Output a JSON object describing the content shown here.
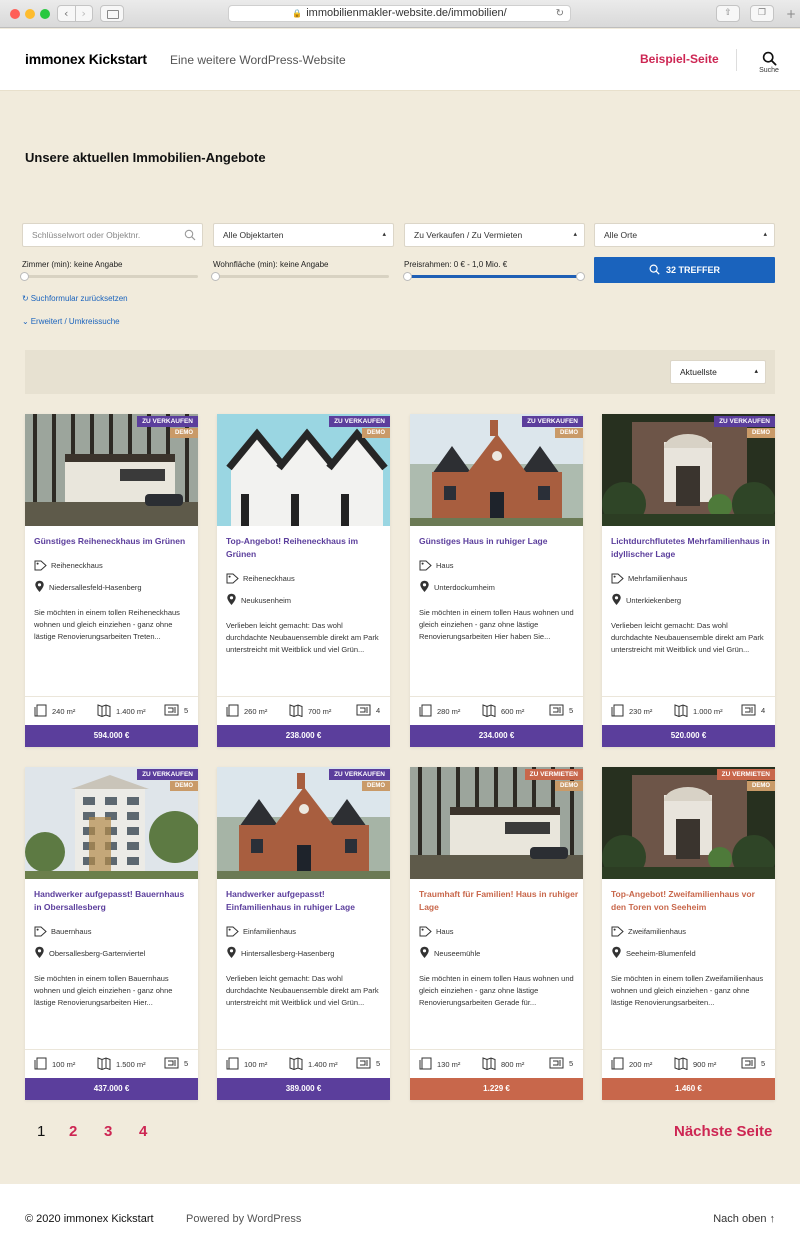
{
  "browser": {
    "url": "immobilienmakler-website.de/immobilien/"
  },
  "header": {
    "site_title": "immonex Kickstart",
    "site_description": "Eine weitere WordPress-Website",
    "menu_item": "Beispiel-Seite",
    "search_label": "Suche"
  },
  "page": {
    "title": "Unsere aktuellen Immobilien-Angebote"
  },
  "search_form": {
    "keyword_placeholder": "Schlüsselwort oder Objektnr.",
    "type_select": "Alle Objektarten",
    "marketing_select": "Zu Verkaufen / Zu Vermieten",
    "location_select": "Alle Orte",
    "rooms_label": "Zimmer (min): keine Angabe",
    "area_label": "Wohnfläche (min): keine Angabe",
    "price_label": "Preisrahmen: 0 € - 1,0 Mio. €",
    "submit_label": "32 TREFFER",
    "reset_link": "Suchformular zurücksetzen",
    "extended_link": "Erweitert / Umkreissuche"
  },
  "sort": {
    "selected": "Aktuellste"
  },
  "colors": {
    "sale": "#5b3e9c",
    "rent": "#c8674b",
    "demo": "#c99a68",
    "accent": "#cd2653",
    "button": "#1a63bd"
  },
  "listings": [
    {
      "badge": "ZU VERKAUFEN",
      "demo": "DEMO",
      "title": "Günstiges Reiheneckhaus im Grünen",
      "type": "Reiheneckhaus",
      "location": "Niedersallesfeld-Hasenberg",
      "description": "Sie möchten in einem tollen Reiheneckhaus wohnen und gleich einziehen - ganz ohne lästige Renovierungsarbeiten Treten...",
      "living_area": "240 m²",
      "plot_area": "1.400 m²",
      "rooms": "5",
      "price": "594.000 €"
    },
    {
      "badge": "ZU VERKAUFEN",
      "demo": "DEMO",
      "title": "Top-Angebot! Reiheneckhaus im Grünen",
      "type": "Reiheneckhaus",
      "location": "Neukusenheim",
      "description": "Verlieben leicht gemacht: Das wohl durchdachte Neubauensemble direkt am Park unterstreicht mit Weitblick und viel Grün...",
      "living_area": "260 m²",
      "plot_area": "700 m²",
      "rooms": "4",
      "price": "238.000 €"
    },
    {
      "badge": "ZU VERKAUFEN",
      "demo": "DEMO",
      "title": "Günstiges Haus in ruhiger Lage",
      "type": "Haus",
      "location": "Unterdockumheim",
      "description": "Sie möchten in einem tollen Haus wohnen und gleich einziehen - ganz ohne lästige Renovierungsarbeiten Hier haben Sie...",
      "living_area": "280 m²",
      "plot_area": "600 m²",
      "rooms": "5",
      "price": "234.000 €"
    },
    {
      "badge": "ZU VERKAUFEN",
      "demo": "DEMO",
      "title": "Lichtdurchflutetes Mehrfamilienhaus in idyllischer Lage",
      "type": "Mehrfamilienhaus",
      "location": "Unterkiekenberg",
      "description": "Verlieben leicht gemacht: Das wohl durchdachte Neubauensemble direkt am Park unterstreicht mit Weitblick und viel Grün...",
      "living_area": "230 m²",
      "plot_area": "1.000 m²",
      "rooms": "4",
      "price": "520.000 €"
    },
    {
      "badge": "ZU VERKAUFEN",
      "demo": "DEMO",
      "title": "Handwerker aufgepasst! Bauernhaus in Obersallesberg",
      "type": "Bauernhaus",
      "location": "Obersallesberg-Gartenviertel",
      "description": "Sie möchten in einem tollen Bauernhaus wohnen und gleich einziehen - ganz ohne lästige Renovierungsarbeiten Hier...",
      "living_area": "100 m²",
      "plot_area": "1.500 m²",
      "rooms": "5",
      "price": "437.000 €"
    },
    {
      "badge": "ZU VERKAUFEN",
      "demo": "DEMO",
      "title": "Handwerker aufgepasst! Einfamilienhaus in ruhiger Lage",
      "type": "Einfamilienhaus",
      "location": "Hintersallesberg-Hasenberg",
      "description": "Verlieben leicht gemacht: Das wohl durchdachte Neubauensemble direkt am Park unterstreicht mit Weitblick und viel Grün...",
      "living_area": "100 m²",
      "plot_area": "1.400 m²",
      "rooms": "5",
      "price": "389.000 €"
    },
    {
      "badge": "ZU VERMIETEN",
      "demo": "DEMO",
      "title": "Traumhaft für Familien! Haus in ruhiger Lage",
      "type": "Haus",
      "location": "Neuseemühle",
      "description": "Sie möchten in einem tollen Haus wohnen und gleich einziehen - ganz ohne lästige Renovierungsarbeiten Gerade für...",
      "living_area": "130 m²",
      "plot_area": "800 m²",
      "rooms": "5",
      "price": "1.229 €"
    },
    {
      "badge": "ZU VERMIETEN",
      "demo": "DEMO",
      "title": "Top-Angebot! Zweifamilienhaus vor den Toren von Seeheim",
      "type": "Zweifamilienhaus",
      "location": "Seeheim-Blumenfeld",
      "description": "Sie möchten in einem tollen Zweifamilienhaus wohnen und gleich einziehen - ganz ohne lästige Renovierungsarbeiten...",
      "living_area": "200 m²",
      "plot_area": "900 m²",
      "rooms": "5",
      "price": "1.460 €"
    }
  ],
  "pagination": {
    "pages": [
      "1",
      "2",
      "3",
      "4"
    ],
    "next": "Nächste Seite"
  },
  "footer": {
    "copyright": "© 2020 immonex Kickstart",
    "powered": "Powered by WordPress",
    "to_top": "Nach oben ↑"
  }
}
